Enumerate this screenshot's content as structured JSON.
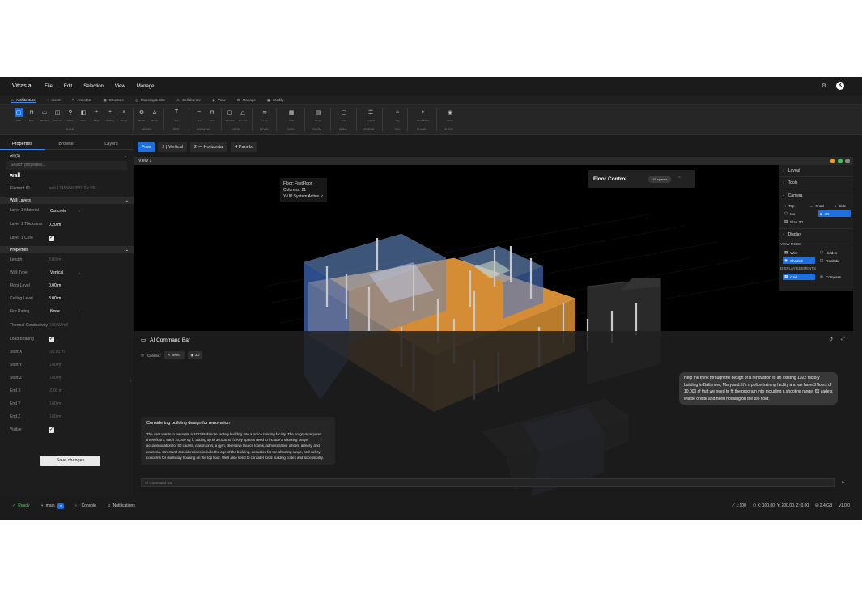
{
  "app": {
    "brand": "Vitras.ai",
    "menus": [
      "File",
      "Edit",
      "Selection",
      "View",
      "Manage"
    ],
    "avatar": "K"
  },
  "tabs": [
    "Architecture",
    "Insert",
    "Annotate",
    "Structure",
    "Massing & Site",
    "Collaborate",
    "View",
    "Manage",
    "Modify"
  ],
  "ribbon": {
    "tools": [
      "Wall",
      "Door",
      "Window",
      "Column",
      "Stairs",
      "Floor",
      "Roof",
      "Railing",
      "Ramp",
      "Model",
      "Group",
      "Text",
      "Line",
      "Door",
      "Window",
      "Dormer",
      "Level",
      "Grid",
      "Room",
      "Area",
      "Legend",
      "Tag",
      "Work Plane",
      "Show"
    ],
    "groups": [
      "BUILD",
      "MODEL",
      "TEXT",
      "DRAWING",
      "VIEW",
      "LEVEL",
      "GRID",
      "ROOM",
      "AREA",
      "LEGEND",
      "TAG",
      "PLANE",
      "SHOW"
    ]
  },
  "panel": {
    "tabs": [
      "Properties",
      "Browser",
      "Layers"
    ],
    "filter": "All (1)",
    "search_placeholder": "Search properties...",
    "object": "wall",
    "element_id_label": "Element ID",
    "element_id": "wall-1745584035010-c1f9...",
    "wall_layers_header": "Wall Layers",
    "layer_material_label": "Layer 1 Material",
    "layer_material": "Concrete",
    "layer_thickness_label": "Layer 1 Thickness",
    "layer_thickness": "0.20 m",
    "layer_core_label": "Layer 1 Core",
    "properties_header": "Properties",
    "rows": [
      {
        "k": "Length",
        "v": "8.00 m",
        "kind": "dim"
      },
      {
        "k": "Wall Type",
        "v": "Vertical",
        "kind": "select"
      },
      {
        "k": "Floor Level",
        "v": "0.00 m",
        "kind": "val"
      },
      {
        "k": "Ceiling Level",
        "v": "3.00 m",
        "kind": "val"
      },
      {
        "k": "Fire Rating",
        "v": "None",
        "kind": "select"
      },
      {
        "k": "Thermal Conductivity",
        "v": "0.00 W/mK",
        "kind": "dim"
      },
      {
        "k": "Load Bearing",
        "v": "",
        "kind": "check"
      },
      {
        "k": "Start X",
        "v": "-10.00 m",
        "kind": "dim"
      },
      {
        "k": "Start Y",
        "v": "0.00 m",
        "kind": "dim"
      },
      {
        "k": "Start Z",
        "v": "0.00 m",
        "kind": "dim"
      },
      {
        "k": "End X",
        "v": "-2.00 m",
        "kind": "dim"
      },
      {
        "k": "End Y",
        "v": "0.00 m",
        "kind": "dim"
      },
      {
        "k": "End Z",
        "v": "0.00 m",
        "kind": "dim"
      },
      {
        "k": "Visible",
        "v": "",
        "kind": "check"
      }
    ],
    "save": "Save changes"
  },
  "views": [
    "Free",
    "2 | Vertical",
    "2 — Horizontal",
    "4 Panels"
  ],
  "view_title": "View 1",
  "floor_info": [
    "Floor: FirstFloor",
    "Columns: 21",
    "Y-UP System Active ✓"
  ],
  "floor_control": {
    "title": "Floor Control",
    "badge": "18 spaces"
  },
  "right_panel": {
    "layout": "Layout",
    "tools": "Tools",
    "camera": "Camera",
    "top": "Top",
    "front": "Front",
    "side": "Side",
    "iso": "Iso",
    "three_d": "3D",
    "plan2d": "Plan 2D",
    "display": "Display",
    "view_mode": "VIEW MODE",
    "wire": "Wire",
    "hidden": "Hidden",
    "shaded": "Shaded",
    "realistic": "Realistic",
    "display_elements": "DISPLAY ELEMENTS",
    "grid": "Grid",
    "compass": "Compass"
  },
  "command_bar": {
    "title": "AI Command Bar",
    "context_label": "Context:",
    "chip_select": "select",
    "chip_3d": "3D",
    "user_message": "Help me think through the design of a renovation to an existing 1922 factory building in Baltimore, Maryland. It's a police training facility and we have 3 floors of 10,000 sf that we need to fit the program into including a shooting range. 60 cadets will be onsite and need housing on the top floor.",
    "ai_title": "Considering building design for renovation",
    "ai_body": "The user wants to renovate a 1922 Baltimore factory building into a police training facility. The program requires three floors, each 10,000 sq ft, adding up to 30,000 sq ft. Key spaces need to include a shooting range, accommodation for 60 cadets, classrooms, a gym, defensive tactics rooms, administrative offices, armory, and cafeteria. Structural considerations include the age of the building, acoustics for the shooting range, and safety concerns for dormitory housing on the top floor. We'll also need to consider local building codes and accessibility.",
    "input_placeholder": "AI Command Bar"
  },
  "status": {
    "ready": "Ready",
    "branch": "main",
    "branch_count": "3",
    "console": "Console",
    "notifications": "Notifications",
    "scale": "1:100",
    "coords": "X: 100.00, Y: 200.00, Z: 0.00",
    "memory": "2.4 GB",
    "version": "v1.0.0"
  },
  "colors": {
    "accent": "#1e6fe0",
    "ready": "#4cc45a",
    "slab_orange": "#e69a3a",
    "glass_blue": "#6e9bdc"
  }
}
